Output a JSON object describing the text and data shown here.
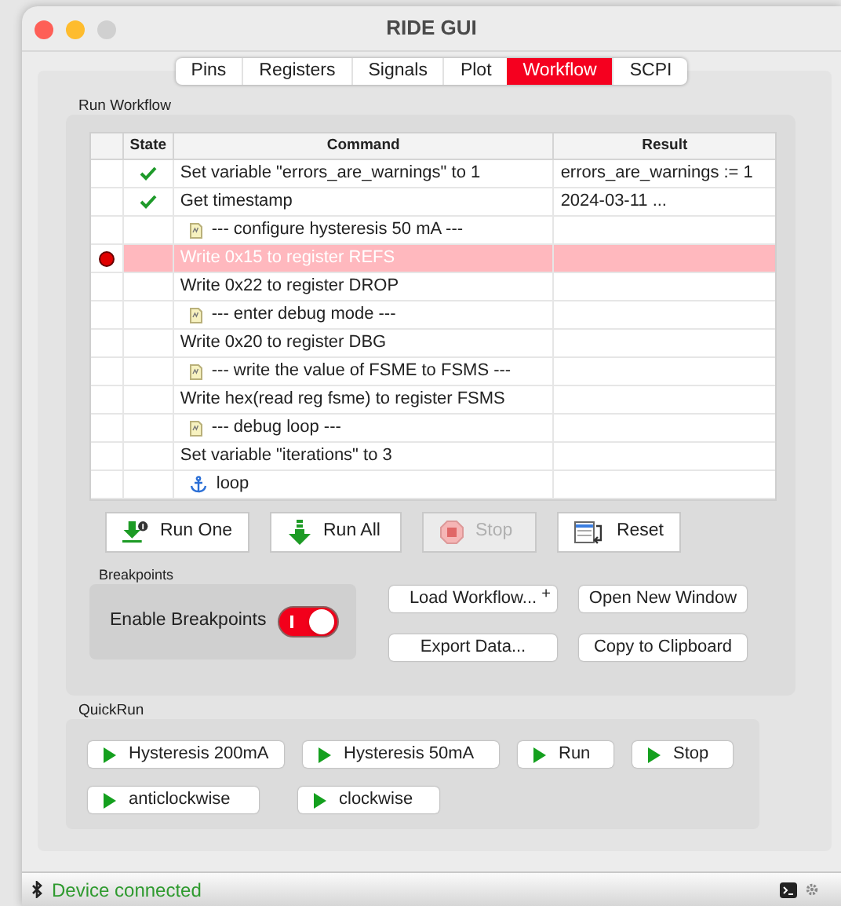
{
  "window": {
    "title": "RIDE GUI"
  },
  "tabs": [
    {
      "label": "Pins",
      "selected": false
    },
    {
      "label": "Registers",
      "selected": false
    },
    {
      "label": "Signals",
      "selected": false
    },
    {
      "label": "Plot",
      "selected": false
    },
    {
      "label": "Workflow",
      "selected": true
    },
    {
      "label": "SCPI",
      "selected": false
    }
  ],
  "run_workflow": {
    "title": "Run Workflow",
    "columns": [
      "State",
      "Command",
      "Result"
    ],
    "rows": [
      {
        "kind": "command",
        "done": true,
        "breakpoint": false,
        "selected": false,
        "command": "Set variable \"errors_are_warnings\" to 1",
        "result": "errors_are_warnings := 1"
      },
      {
        "kind": "command",
        "done": true,
        "breakpoint": false,
        "selected": false,
        "command": "Get timestamp",
        "result": "2024-03-11 ..."
      },
      {
        "kind": "comment",
        "done": false,
        "breakpoint": false,
        "selected": false,
        "command": "--- configure hysteresis 50 mA ---"
      },
      {
        "kind": "command",
        "done": false,
        "breakpoint": true,
        "selected": true,
        "command": "Write 0x15 to register REFS"
      },
      {
        "kind": "command",
        "done": false,
        "breakpoint": false,
        "selected": false,
        "command": "Write 0x22 to register DROP"
      },
      {
        "kind": "comment",
        "done": false,
        "breakpoint": false,
        "selected": false,
        "command": "--- enter debug mode ---"
      },
      {
        "kind": "command",
        "done": false,
        "breakpoint": false,
        "selected": false,
        "command": "Write 0x20 to register DBG"
      },
      {
        "kind": "comment",
        "done": false,
        "breakpoint": false,
        "selected": false,
        "command": "--- write the value of FSME to FSMS ---"
      },
      {
        "kind": "command",
        "done": false,
        "breakpoint": false,
        "selected": false,
        "command": "Write hex(read reg fsme) to register FSMS"
      },
      {
        "kind": "comment",
        "done": false,
        "breakpoint": false,
        "selected": false,
        "command": "--- debug loop ---"
      },
      {
        "kind": "command",
        "done": false,
        "breakpoint": false,
        "selected": false,
        "command": "Set variable \"iterations\" to 3"
      },
      {
        "kind": "anchor",
        "done": false,
        "breakpoint": false,
        "selected": false,
        "command": "loop"
      }
    ]
  },
  "actions": [
    {
      "kind": "run_one",
      "label": "Run One",
      "disabled": false
    },
    {
      "kind": "run_all",
      "label": "Run All",
      "disabled": false
    },
    {
      "kind": "stop",
      "label": "Stop",
      "disabled": true
    },
    {
      "kind": "reset",
      "label": "Reset",
      "disabled": false
    }
  ],
  "breakpoints": {
    "title": "Breakpoints",
    "label": "Enable Breakpoints",
    "on": true
  },
  "file_buttons": [
    {
      "label": "Load Workflow...",
      "badge": "+"
    },
    {
      "label": "Open New Window"
    },
    {
      "label": "Export Data..."
    },
    {
      "label": "Copy to Clipboard"
    }
  ],
  "quickrun": {
    "title": "QuickRun",
    "buttons": [
      "Hysteresis 200mA",
      "Hysteresis 50mA",
      "Run",
      "Stop",
      "anticlockwise",
      "clockwise"
    ]
  },
  "status_bar": {
    "text": "Device connected"
  }
}
